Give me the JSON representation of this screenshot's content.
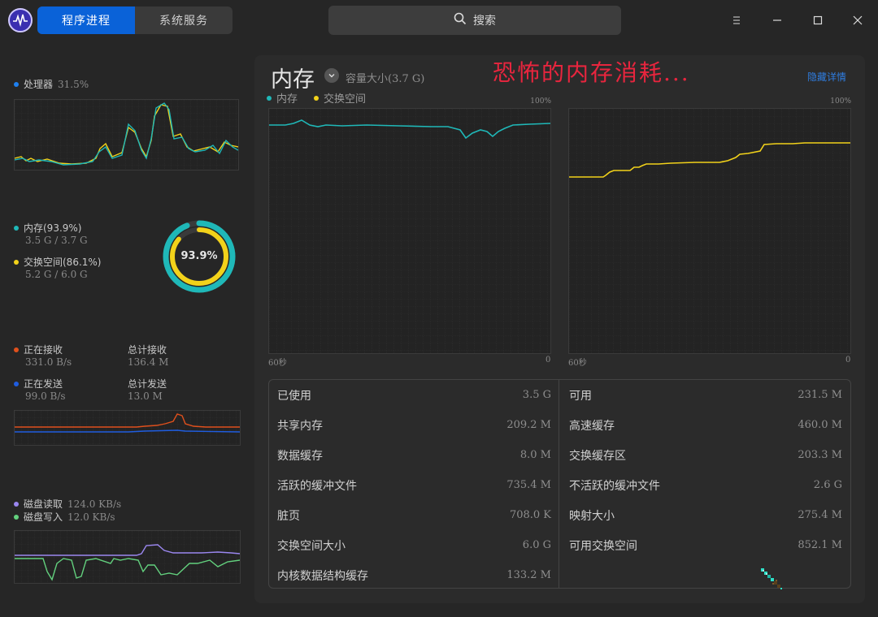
{
  "titlebar": {
    "tabs": [
      "程序进程",
      "系统服务"
    ],
    "search_label": "搜索"
  },
  "cpu": {
    "label": "处理器",
    "value": "31.5%"
  },
  "memory": {
    "label": "内存(93.9%)",
    "detail": "3.5 G / 3.7 G",
    "swap_label": "交换空间(86.1%)",
    "swap_detail": "5.2 G / 6.0 G",
    "ring_value": "93.9%",
    "mem_fraction": 0.939,
    "swap_fraction": 0.861
  },
  "network": {
    "recv_label": "正在接收",
    "recv_value": "331.0 B/s",
    "total_recv_label": "总计接收",
    "total_recv_value": "136.4 M",
    "send_label": "正在发送",
    "send_value": "99.0 B/s",
    "total_send_label": "总计发送",
    "total_send_value": "13.0 M"
  },
  "disk": {
    "read_label": "磁盘读取",
    "read_value": "124.0 KB/s",
    "write_label": "磁盘写入",
    "write_value": "12.0 KB/s"
  },
  "main": {
    "title": "内存",
    "capacity": "容量大小(3.7 G)",
    "annotation": "恐怖的内存消耗...",
    "hide_details": "隐藏详情",
    "legend_mem": "内存",
    "legend_swap": "交换空间",
    "axis_top": "100%",
    "axis_left": "60秒",
    "axis_right": "0"
  },
  "details": {
    "left": [
      {
        "label": "已使用",
        "value": "3.5 G"
      },
      {
        "label": "共享内存",
        "value": "209.2 M"
      },
      {
        "label": "数据缓存",
        "value": "8.0 M"
      },
      {
        "label": "活跃的缓冲文件",
        "value": "735.4 M"
      },
      {
        "label": "脏页",
        "value": "708.0 K"
      },
      {
        "label": "交换空间大小",
        "value": "6.0 G"
      },
      {
        "label": "内核数据结构缓存",
        "value": "133.2 M"
      }
    ],
    "right": [
      {
        "label": "可用",
        "value": "231.5 M"
      },
      {
        "label": "高速缓存",
        "value": "460.0 M"
      },
      {
        "label": "交换缓存区",
        "value": "203.3 M"
      },
      {
        "label": "不活跃的缓冲文件",
        "value": "2.6 G"
      },
      {
        "label": "映射大小",
        "value": "275.4 M"
      },
      {
        "label": "可用交换空间",
        "value": "852.1 M"
      }
    ]
  },
  "colors": {
    "accent": "#0a62d8",
    "mem": "#1fb8b8",
    "swap": "#f2d21a",
    "recv": "#e0501c",
    "send": "#1f5de0",
    "read": "#9b87f0",
    "write": "#63d17e",
    "annotation": "#e8253e"
  }
}
